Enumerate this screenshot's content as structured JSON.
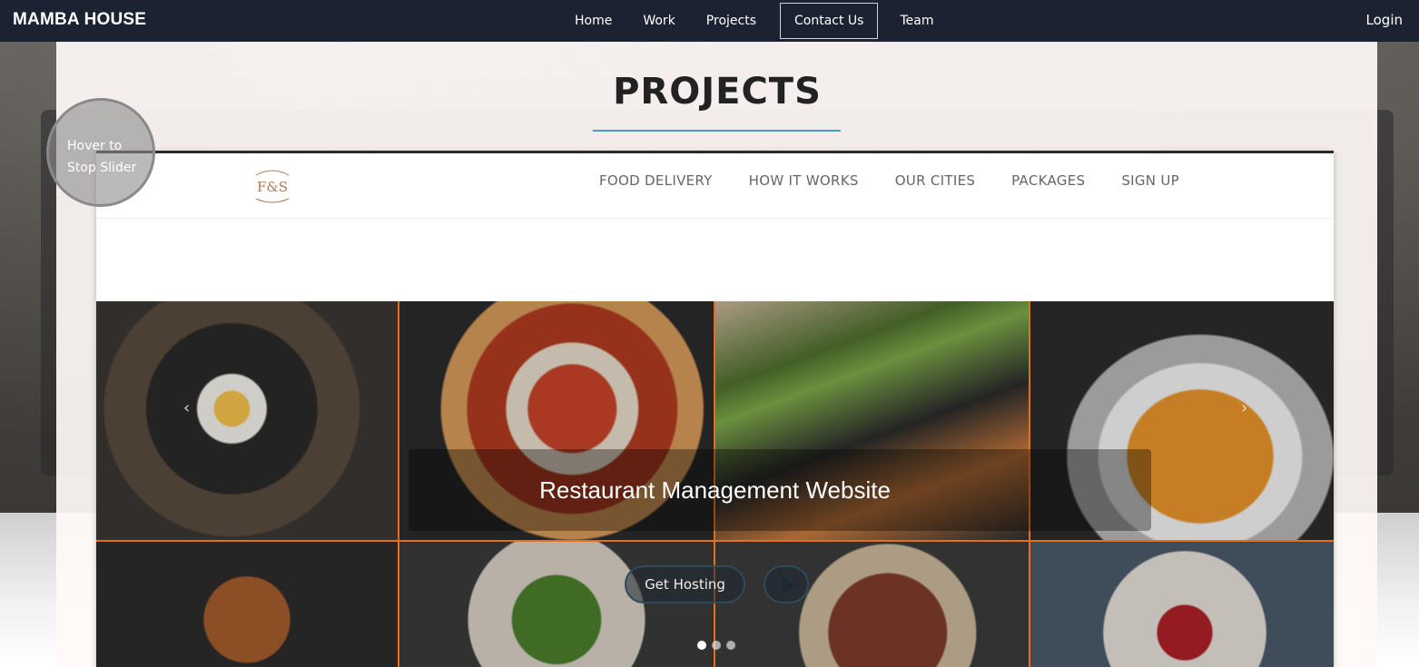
{
  "navbar": {
    "brand": "MAMBA HOUSE",
    "links": [
      "Home",
      "Work",
      "Projects",
      "Contact Us",
      "Team"
    ],
    "active": "Contact Us",
    "login": "Login"
  },
  "section": {
    "title": "PROJECTS",
    "hover_hint": "Hover to Stop Slider"
  },
  "slide": {
    "logo_text": "F&S",
    "menu": [
      "FOOD DELIVERY",
      "HOW IT WORKS",
      "OUR CITIES",
      "PACKAGES",
      "SIGN UP"
    ],
    "caption": "Restaurant Management Website",
    "cta_label": "Get Hosting",
    "dots": 3,
    "active_dot": 1
  },
  "colors": {
    "navbar_bg": "#1b2333",
    "title_underline": "#4a9ccc",
    "grid_border": "#e0721f"
  }
}
